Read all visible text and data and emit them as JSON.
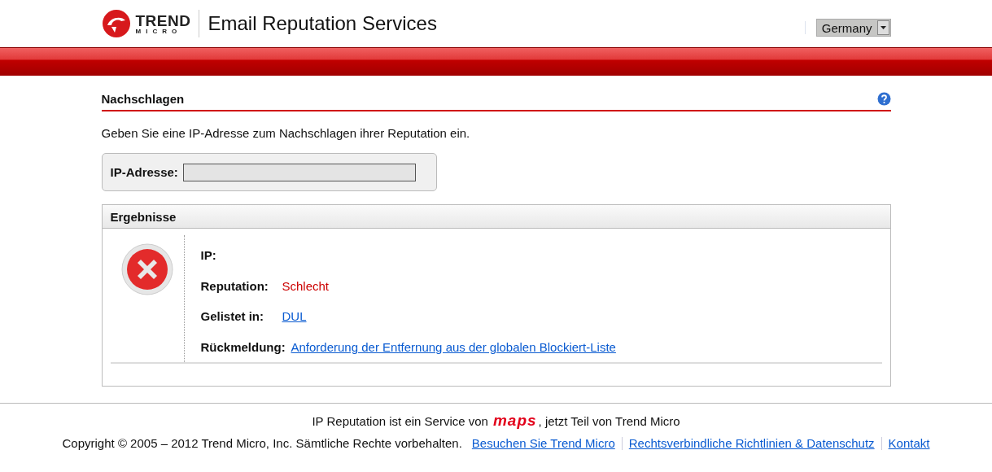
{
  "header": {
    "logo_top": "TREND",
    "logo_bottom": "MICRO",
    "title": "Email Reputation Services",
    "country": "Germany"
  },
  "lookup": {
    "heading": "Nachschlagen",
    "intro": "Geben Sie eine IP-Adresse zum Nachschlagen ihrer Reputation ein.",
    "field_label": "IP-Adresse:"
  },
  "results": {
    "heading": "Ergebnisse",
    "error": true,
    "rows": [
      {
        "label": "IP:",
        "kind": "text"
      },
      {
        "label": "Reputation:",
        "value": "Schlecht",
        "kind": "alert"
      },
      {
        "label": "Gelistet in:",
        "value": "DUL",
        "kind": "link"
      },
      {
        "label": "Rückmeldung:",
        "value": "Anforderung der Entfernung aus der globalen Blockiert-Liste",
        "kind": "link"
      }
    ]
  },
  "footer": {
    "service_before": "IP Reputation ist ein Service von",
    "service_logo": "maps",
    "service_after": ", jetzt Teil von Trend Micro",
    "copyright": "Copyright © 2005 – 2012 Trend Micro, Inc. Sämtliche Rechte vorbehalten.",
    "links": [
      "Besuchen Sie Trend Micro",
      "Rechtsverbindliche Richtlinien & Datenschutz",
      "Kontakt"
    ]
  }
}
